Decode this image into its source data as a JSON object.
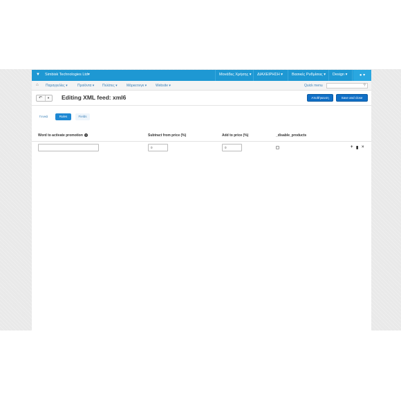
{
  "topbar": {
    "company": "Simbisk Technologies Ltd",
    "nav": [
      "Μονάδες Χρήσης",
      "ΔΙΑΧΕΙΡΗΣΗ",
      "Βασικές Ρυθμίσεις",
      "Design"
    ],
    "caret": "▾",
    "user_icon": "user-icon",
    "accent": "#1e98d3"
  },
  "subbar": {
    "nav": [
      "Παραγγελίες ▾",
      "Προϊόντα ▾",
      "Πελάτες ▾",
      "Μάρκετινγκ ▾",
      "Website ▾"
    ],
    "quick_menu": "Quick menu",
    "search_value": ""
  },
  "page": {
    "title": "Editing XML feed: xml6",
    "save_label": "Αποθήκευση",
    "save_close_label": "Save and close",
    "primary_color": "#0f6fc6"
  },
  "tabs": [
    "Γενικά",
    "Rules",
    "Fields"
  ],
  "active_tab": "Rules",
  "table": {
    "headers": [
      "Word to activate promotion",
      "Subtract from price (%)",
      "Add to price (%)",
      "_disable_products"
    ],
    "rows": [
      {
        "word": "",
        "subtract": "0",
        "add": "0",
        "disable_products": false
      }
    ]
  }
}
